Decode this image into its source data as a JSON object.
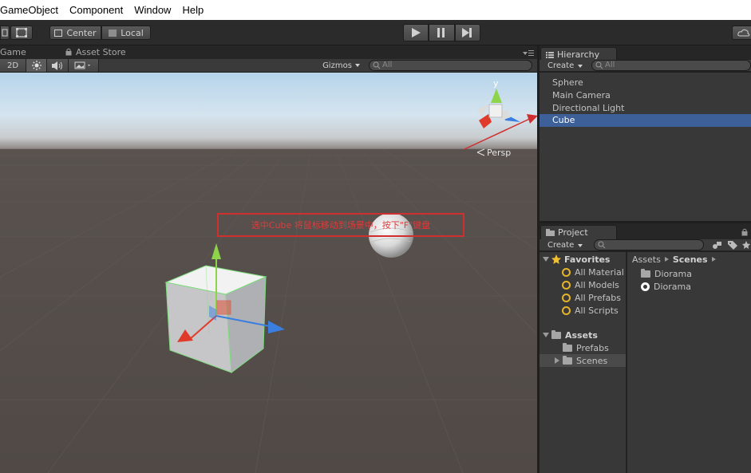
{
  "menu": {
    "items": [
      "GameObject",
      "Component",
      "Window",
      "Help"
    ]
  },
  "toolbar": {
    "pivot_label": "Center",
    "space_label": "Local"
  },
  "scene": {
    "tab_game": "Game",
    "tab_asset_store": "Asset Store",
    "mode_2d": "2D",
    "gizmos_label": "Gizmos",
    "search_placeholder": "All",
    "persp_label": "Persp",
    "annotation": "选中Cube 将鼠标移动到场景中，按下\"F\"键盘",
    "axis_y": "y"
  },
  "hierarchy": {
    "title": "Hierarchy",
    "create_label": "Create",
    "search_placeholder": "All",
    "items": [
      "Sphere",
      "Main Camera",
      "Directional Light",
      "Cube"
    ]
  },
  "project": {
    "title": "Project",
    "create_label": "Create",
    "favorites_label": "Favorites",
    "favorites": [
      "All Material",
      "All Models",
      "All Prefabs",
      "All Scripts"
    ],
    "assets_label": "Assets",
    "folders": [
      "Prefabs",
      "Scenes"
    ],
    "breadcrumb": [
      "Assets",
      "Scenes"
    ],
    "files": [
      "Diorama",
      "Diorama"
    ]
  },
  "colors": {
    "selection": "#3d6098",
    "annotation": "#d02f2f",
    "y_axis": "#8ed44a",
    "x_axis": "#e03a2a",
    "z_axis": "#3a7ee0"
  }
}
